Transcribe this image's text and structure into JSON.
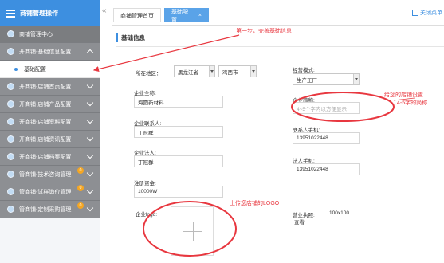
{
  "sidebar": {
    "brand": "商铺管理操作",
    "items": [
      {
        "label": "商铺管理中心",
        "type": "top"
      },
      {
        "label": "开商铺-基础信息配置",
        "type": "group",
        "expanded": true
      },
      {
        "label": "基础配置",
        "type": "sub"
      },
      {
        "label": "开商铺-店铺首页配置",
        "type": "group"
      },
      {
        "label": "开商铺-店铺产品配置",
        "type": "group"
      },
      {
        "label": "开商铺-店铺资料配置",
        "type": "group"
      },
      {
        "label": "开商铺-店铺资讯配置",
        "type": "group"
      },
      {
        "label": "开商铺-店铺档案配置",
        "type": "group"
      },
      {
        "label": "管商铺-技术咨询管理",
        "type": "group",
        "badge": "0"
      },
      {
        "label": "管商铺-试样询价管理",
        "type": "group",
        "badge": "0"
      },
      {
        "label": "管商铺-定制采购管理",
        "type": "group",
        "badge": "0"
      }
    ],
    "collapse_symbol": "«"
  },
  "tabs": [
    {
      "label": "商铺管理首页"
    },
    {
      "label": "基础配置",
      "close": "×"
    }
  ],
  "close_all": "关闭菜单",
  "section_title": "基础信息",
  "form": {
    "region_label": "所在地区：",
    "province": "黑龙江省",
    "city": "鸡西市",
    "business_mode_label": "经营模式:",
    "business_mode": "生产工厂",
    "company_name_label": "企业全称:",
    "company_name": "海圆新材料",
    "short_name_label": "企业简称:",
    "short_name_placeholder": "4~5个字内以方便显示",
    "contact_label": "企业联系人:",
    "contact": "丁冠群",
    "contact_phone_label": "联系人手机:",
    "contact_phone": "13951022448",
    "legal_label": "企业法人:",
    "legal": "丁冠群",
    "legal_phone_label": "法人手机:",
    "legal_phone": "13951022448",
    "capital_label": "注册资金:",
    "capital": "10000W",
    "logo_label": "企业logo:",
    "license_label": "营业执照:",
    "license_view": "查看",
    "license_size": "100x100"
  },
  "annotations": {
    "step1": "第一步，完善基础信息",
    "shop_name_1": "给您的店铺设置",
    "shop_name_2": "4-5字的简称",
    "logo_hint": "上传您店铺的LOGO"
  },
  "colors": {
    "accent": "#3d8fe0",
    "annotation": "#e8373f",
    "sidebar_group": "#8d8f93"
  }
}
